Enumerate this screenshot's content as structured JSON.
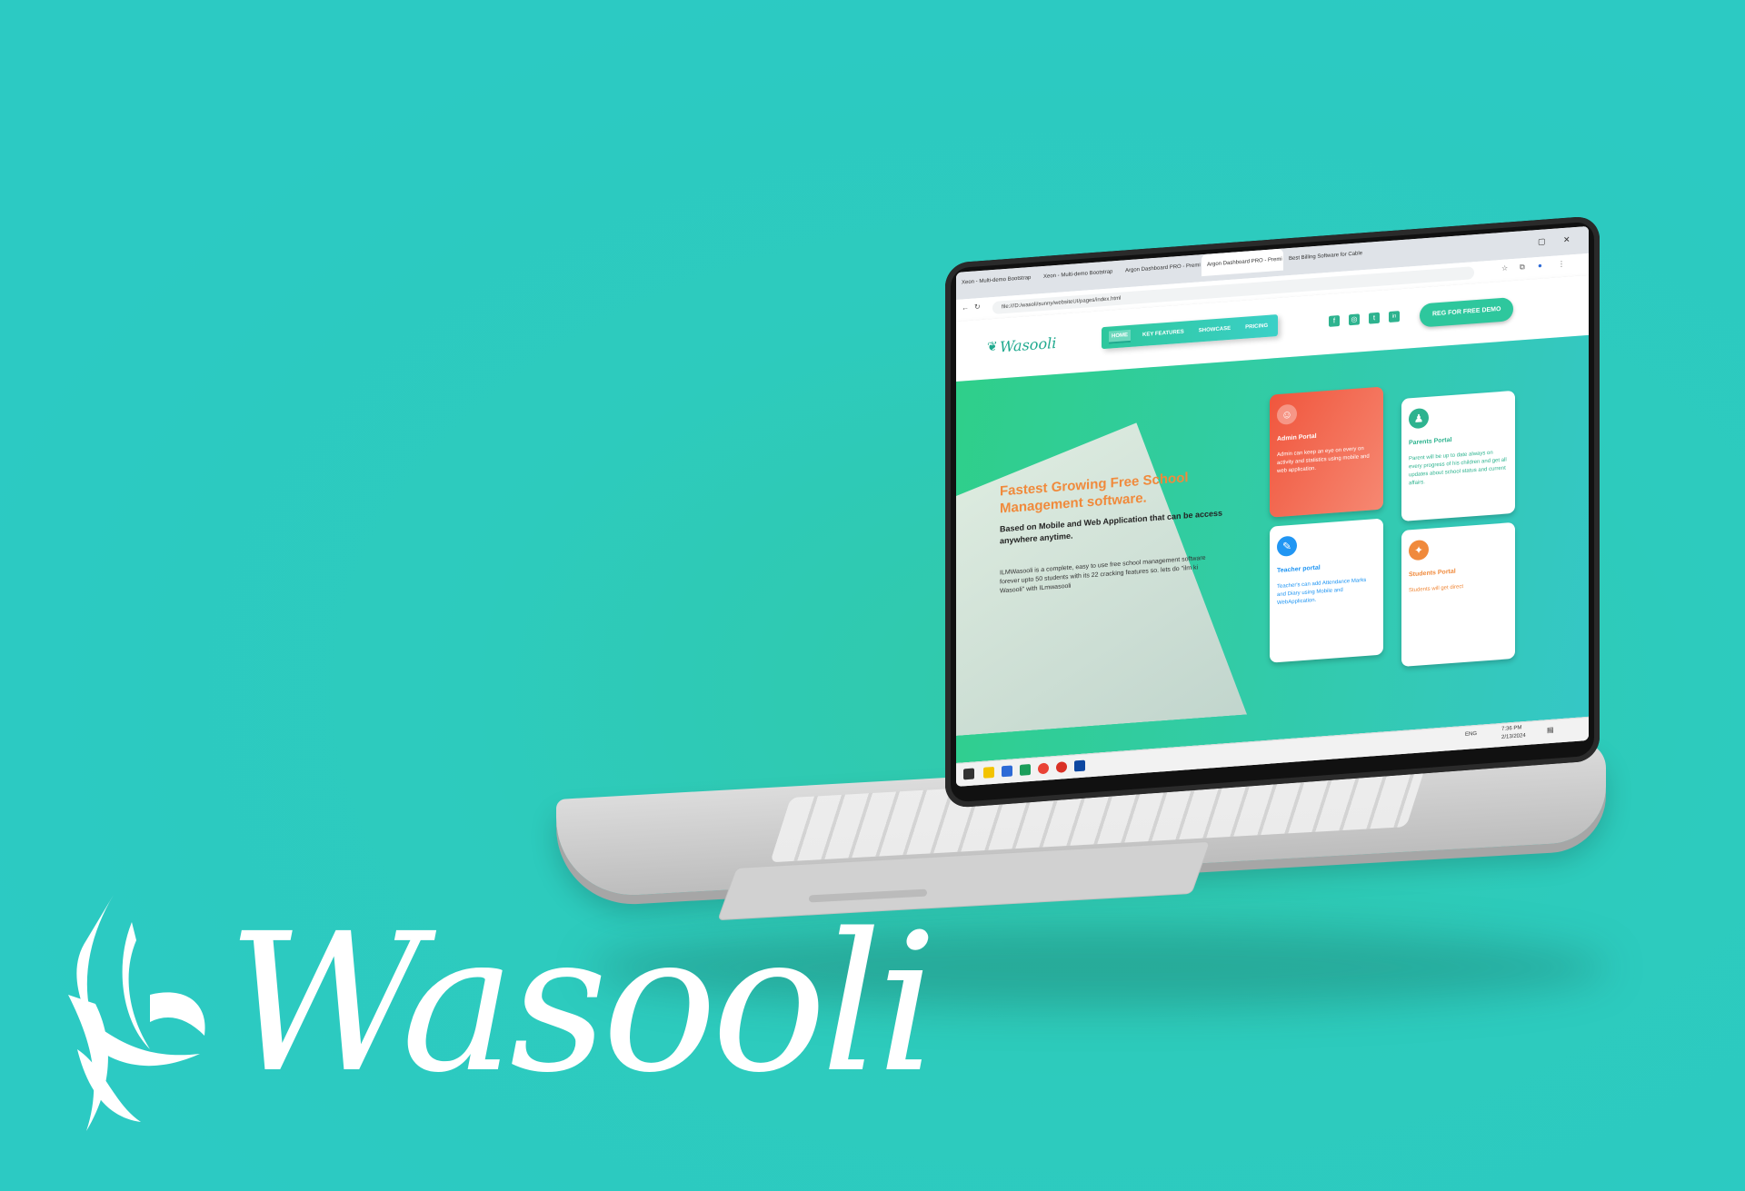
{
  "brand": {
    "wordmark": "Wasooli",
    "color": "#ffffff",
    "background": "#2ccac3"
  },
  "browser": {
    "tabs": [
      "Xeon - Multi-demo Bootstrap",
      "Xeon - Multi-demo Bootstrap",
      "Argon Dashboard PRO - Premi",
      "Argon Dashboard PRO - Premi",
      "Best Billing Software for Cable"
    ],
    "url": "file:///D:/wasoli/sunny/websiteUI/pages/index.html"
  },
  "site": {
    "logo": "Wasooli",
    "nav": [
      "HOME",
      "KEY FEATURES",
      "SHOWCASE",
      "PRICING"
    ],
    "social": [
      "f",
      "◎",
      "t",
      "in"
    ],
    "demo_button": "REG FOR FREE DEMO",
    "hero": {
      "title": "Fastest Growing Free School Management software.",
      "subtitle": "Based on Mobile and Web Application that can be access anywhere anytime.",
      "body": "ILMWasooli is a complete, easy to use free school management software forever upto 50 students with its 22 cracking features so. lets do \"ilm ki Wasooli\" with ILmwasooli"
    },
    "cards": [
      {
        "title": "Admin Portal",
        "desc": "Admin can keep an eye on every on activity and statistics using mobile and web application.",
        "icon": "admin-icon",
        "color": "#f0563d"
      },
      {
        "title": "Parents Portal",
        "desc": "Parent will be up to date always on every progress of his children and get all updates about school status and current affairs.",
        "icon": "parents-icon",
        "color": "#2eb38f"
      },
      {
        "title": "Teacher portal",
        "desc": "Teacher's can add Attendance Marks and Diary using Mobile and WebApplication.",
        "icon": "teacher-icon",
        "color": "#2196f3"
      },
      {
        "title": "Students Portal",
        "desc": "Students will get direct",
        "icon": "student-icon",
        "color": "#f08a3c"
      }
    ]
  },
  "taskbar": {
    "time": "7:36 PM",
    "date": "2/13/2024",
    "lang": "ENG"
  }
}
